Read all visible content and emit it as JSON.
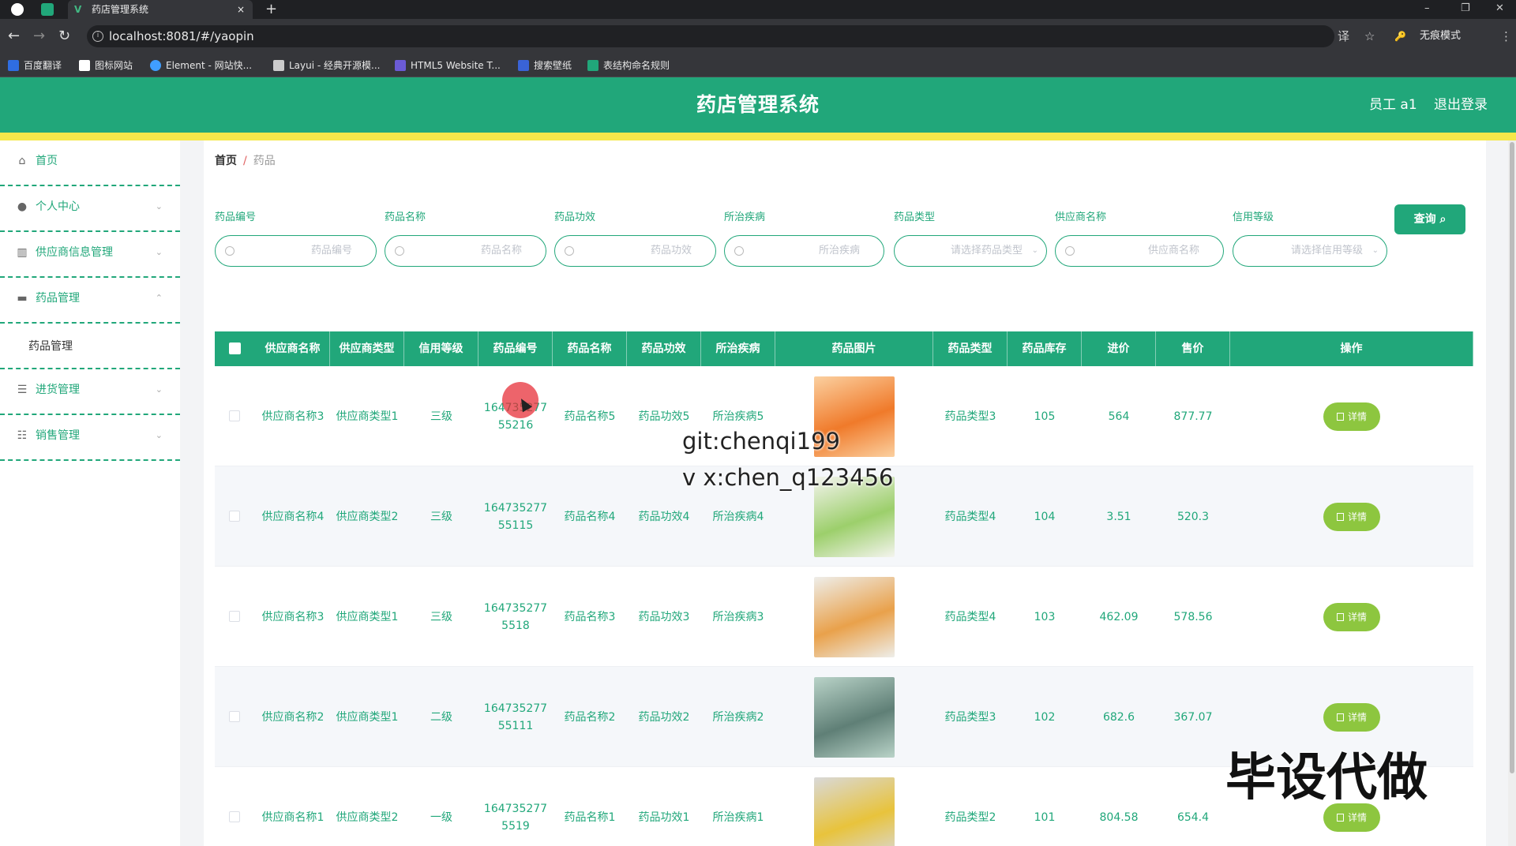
{
  "browser": {
    "tab_title": "药店管理系统",
    "tab_close": "×",
    "new_tab": "+",
    "url": "localhost:8081/#/yaopin",
    "incognito_label": "无痕模式",
    "minimize": "–",
    "maximize": "❐",
    "close": "✕",
    "back": "←",
    "forward": "→",
    "reload": "↻",
    "translate": "译",
    "star": "☆",
    "key": "🔑",
    "menu": "⋮"
  },
  "bookmarks": [
    {
      "label": "百度翻译",
      "color": "#2f6de1"
    },
    {
      "label": "图标网站",
      "color": "#ffffff"
    },
    {
      "label": "Element - 网站快...",
      "color": "#409eff"
    },
    {
      "label": "Layui - 经典开源模...",
      "color": "#cccccc"
    },
    {
      "label": "HTML5 Website T...",
      "color": "#6b5bd6"
    },
    {
      "label": "搜索壁纸",
      "color": "#3a63d6"
    },
    {
      "label": "表结构命名规则",
      "color": "#21a77a"
    }
  ],
  "header": {
    "title": "药店管理系统",
    "user": "员工 a1",
    "logout": "退出登录"
  },
  "sidebar": {
    "items": [
      {
        "label": "首页",
        "icon": "home-icon"
      },
      {
        "label": "个人中心",
        "icon": "user-icon"
      },
      {
        "label": "供应商信息管理",
        "icon": "chart-icon"
      },
      {
        "label": "药品管理",
        "icon": "monitor-icon"
      },
      {
        "label": "药品管理",
        "icon": ""
      },
      {
        "label": "进货管理",
        "icon": "menu-icon"
      },
      {
        "label": "销售管理",
        "icon": "sliders-icon"
      }
    ]
  },
  "breadcrumb": {
    "home": "首页",
    "sep": "/",
    "current": "药品"
  },
  "filters": [
    {
      "label": "药品编号",
      "placeholder": "药品编号",
      "type": "input"
    },
    {
      "label": "药品名称",
      "placeholder": "药品名称",
      "type": "input"
    },
    {
      "label": "药品功效",
      "placeholder": "药品功效",
      "type": "input"
    },
    {
      "label": "所治疾病",
      "placeholder": "所治疾病",
      "type": "input"
    },
    {
      "label": "药品类型",
      "placeholder": "请选择药品类型",
      "type": "select"
    },
    {
      "label": "供应商名称",
      "placeholder": "供应商名称",
      "type": "input"
    },
    {
      "label": "信用等级",
      "placeholder": "请选择信用等级",
      "type": "select"
    }
  ],
  "query_button": "查询 ⌕",
  "table": {
    "columns": [
      "供应商名称",
      "供应商类型",
      "信用等级",
      "药品编号",
      "药品名称",
      "药品功效",
      "所治疾病",
      "药品图片",
      "药品类型",
      "药品库存",
      "进价",
      "售价",
      "操作"
    ],
    "detail_label": "详情",
    "rows": [
      {
        "supplier": "供应商名称3",
        "stype": "供应商类型1",
        "credit": "三级",
        "code": "16473527755216",
        "name": "药品名称5",
        "effect": "药品功效5",
        "disease": "所治疾病5",
        "img": [
          "#f07a2a",
          "#fbd0a0"
        ],
        "dtype": "药品类型3",
        "stock": "105",
        "cost": "564",
        "price": "877.77"
      },
      {
        "supplier": "供应商名称4",
        "stype": "供应商类型2",
        "credit": "三级",
        "code": "16473527755115",
        "name": "药品名称4",
        "effect": "药品功效4",
        "disease": "所治疾病4",
        "img": [
          "#9ccf6b",
          "#f4f4ee"
        ],
        "dtype": "药品类型4",
        "stock": "104",
        "cost": "3.51",
        "price": "520.3"
      },
      {
        "supplier": "供应商名称3",
        "stype": "供应商类型1",
        "credit": "三级",
        "code": "1647352775518",
        "name": "药品名称3",
        "effect": "药品功效3",
        "disease": "所治疾病3",
        "img": [
          "#e9a14b",
          "#eeeeea"
        ],
        "dtype": "药品类型4",
        "stock": "103",
        "cost": "462.09",
        "price": "578.56"
      },
      {
        "supplier": "供应商名称2",
        "stype": "供应商类型1",
        "credit": "二级",
        "code": "16473527755111",
        "name": "药品名称2",
        "effect": "药品功效2",
        "disease": "所治疾病2",
        "img": [
          "#5f7f76",
          "#b9d3c8"
        ],
        "dtype": "药品类型3",
        "stock": "102",
        "cost": "682.6",
        "price": "367.07"
      },
      {
        "supplier": "供应商名称1",
        "stype": "供应商类型2",
        "credit": "一级",
        "code": "1647352775519",
        "name": "药品名称1",
        "effect": "药品功效1",
        "disease": "所治疾病1",
        "img": [
          "#e8c33c",
          "#d9d9d9"
        ],
        "dtype": "药品类型2",
        "stock": "101",
        "cost": "804.58",
        "price": "654.4"
      }
    ]
  },
  "watermarks": [
    "git:chenqi199",
    "v x:chen_q123456",
    "毕设代做"
  ],
  "colors": {
    "primary": "#21a77a",
    "accent_yellow": "#f5e74a",
    "detail_button": "#8dc63f"
  }
}
